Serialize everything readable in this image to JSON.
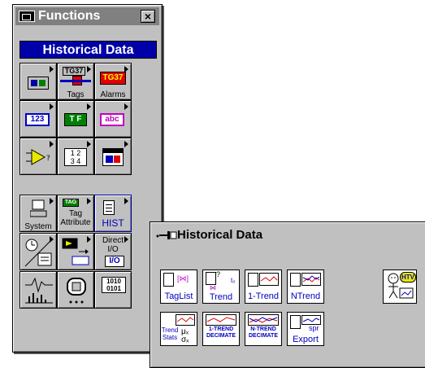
{
  "functions_palette": {
    "title": "Functions",
    "close_glyph": "×",
    "subtitle": "Historical Data",
    "cells": {
      "tags": "Tags",
      "tg37_top": "TG37",
      "tg37_alarm": "TG37",
      "alarms": "Alarms",
      "numeric": "123",
      "boolean": "T F",
      "string": "abc",
      "cluster": "1 2",
      "array_digits": "3 4",
      "system": "System",
      "tag_badge": "TAG",
      "tag_attribute": "Tag\nAttribute",
      "hist": "HIST",
      "direct_io": "Direct\nI/O",
      "io_badge": "I/O",
      "binary_digits": "1010\n0101"
    }
  },
  "historical_palette": {
    "title": "Historical Data",
    "items": {
      "taglist": "TagList",
      "trend": "Trend",
      "one_trend": "1-Trend",
      "n_trend": "NTrend",
      "htv": "HTV",
      "trend_stats": "Trend\nStats",
      "one_trend_decimate": "1-TREND\nDECIMATE",
      "n_trend_decimate": "N-TREND\nDECIMATE",
      "spr_export": "Export",
      "spr": "spr"
    }
  },
  "colors": {
    "subtitle_bg": "#0000a8",
    "alarm_red": "#e00000",
    "tag_green": "#008000",
    "link_blue": "#0000c0"
  }
}
